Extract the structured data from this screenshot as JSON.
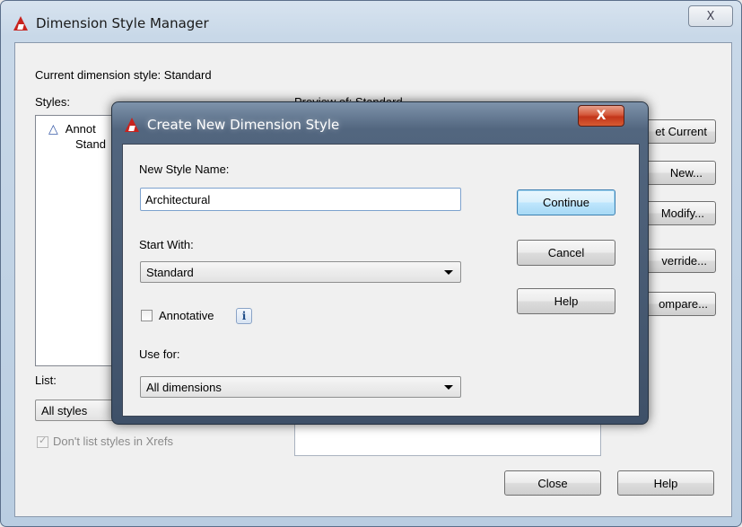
{
  "outer": {
    "title": "Dimension Style Manager",
    "close_label": "X",
    "current_style_label": "Current dimension style: Standard",
    "styles_label": "Styles:",
    "styles_items": [
      "Annot",
      "Stand"
    ],
    "preview_label": "Preview of: Standard",
    "side_buttons": [
      "et Current",
      "New...",
      "Modify...",
      "verride...",
      "ompare..."
    ],
    "list_label": "List:",
    "list_select_value": "All styles",
    "xrefs_checkbox_label": "Don't list styles in Xrefs",
    "close_button": "Close",
    "help_button": "Help"
  },
  "modal": {
    "title": "Create New Dimension Style",
    "close_label": "X",
    "new_style_name_label": "New Style Name:",
    "new_style_name_value": "Architectural",
    "start_with_label": "Start With:",
    "start_with_value": "Standard",
    "annotative_label": "Annotative",
    "info_glyph": "i",
    "use_for_label": "Use for:",
    "use_for_value": "All dimensions",
    "continue_button": "Continue",
    "cancel_button": "Cancel",
    "help_button": "Help"
  },
  "colors": {
    "app_icon_red": "#c8231e",
    "close_button_red": "#c2351a",
    "default_button_blue": "#3c7fb1"
  },
  "icons": [
    "autocad-app-icon",
    "close-icon",
    "annotative-icon",
    "info-icon",
    "dropdown-arrow-icon",
    "checkbox"
  ]
}
